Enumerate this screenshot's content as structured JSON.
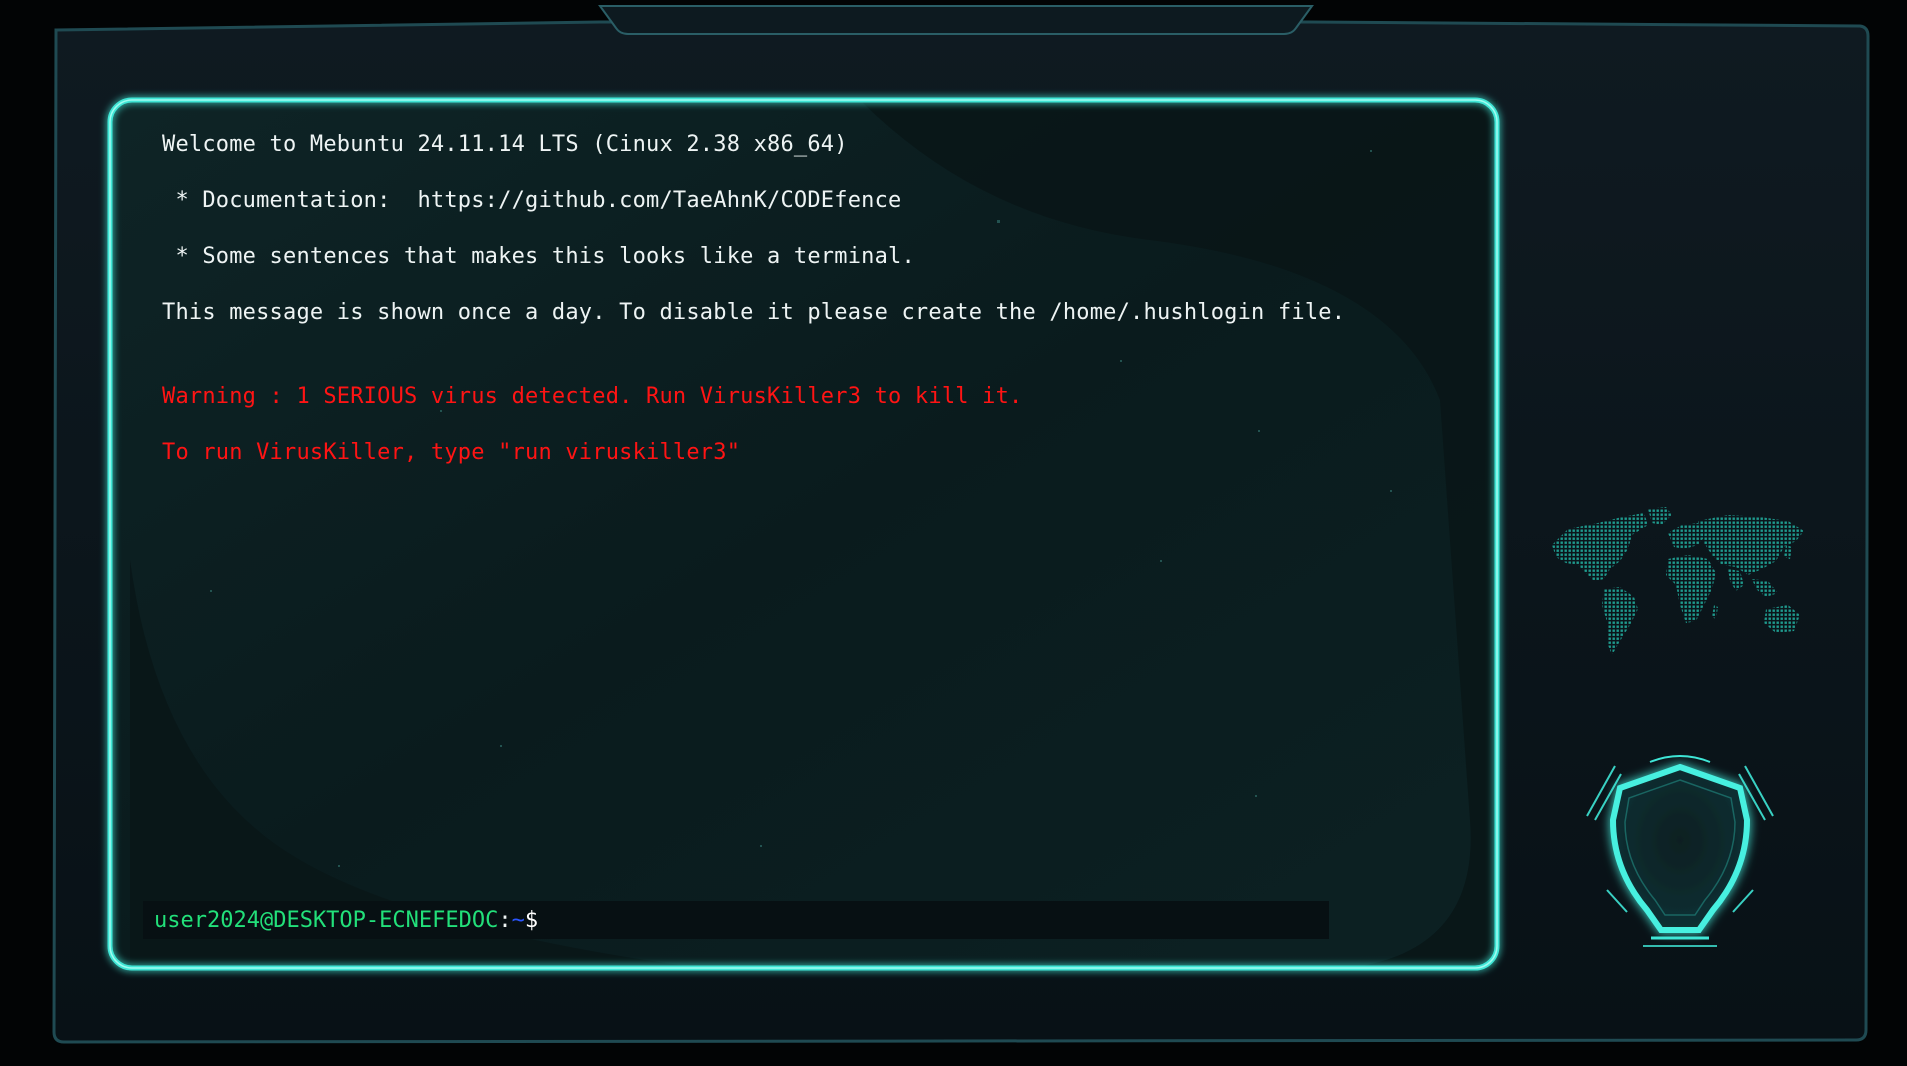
{
  "terminal": {
    "motd": [
      "Welcome to Mebuntu 24.11.14 LTS (Cinux 2.38 x86_64)",
      " * Documentation:  https://github.com/TaeAhnK/CODEfence",
      " * Some sentences that makes this looks like a terminal.",
      "This message is shown once a day. To disable it please create the /home/.hushlogin file."
    ],
    "warnings": [
      "Warning : 1 SERIOUS virus detected. Run VirusKiller3 to kill it.",
      "To run VirusKiller, type \"run viruskiller3\""
    ],
    "prompt": {
      "user_host": "user2024@DESKTOP-ECNEFEDOC",
      "colon": ":",
      "path": "~",
      "dollar": "$",
      "input_value": ""
    }
  },
  "icons": {
    "world_map": "world-map-icon",
    "shield": "shield-icon"
  },
  "colors": {
    "frame_glow": "#3fe6d6",
    "panel_bg": "#0b1d1f",
    "text": "#eef4f4",
    "warning": "#ff1414",
    "prompt_user": "#22e07a",
    "prompt_path": "#2a55ff"
  }
}
